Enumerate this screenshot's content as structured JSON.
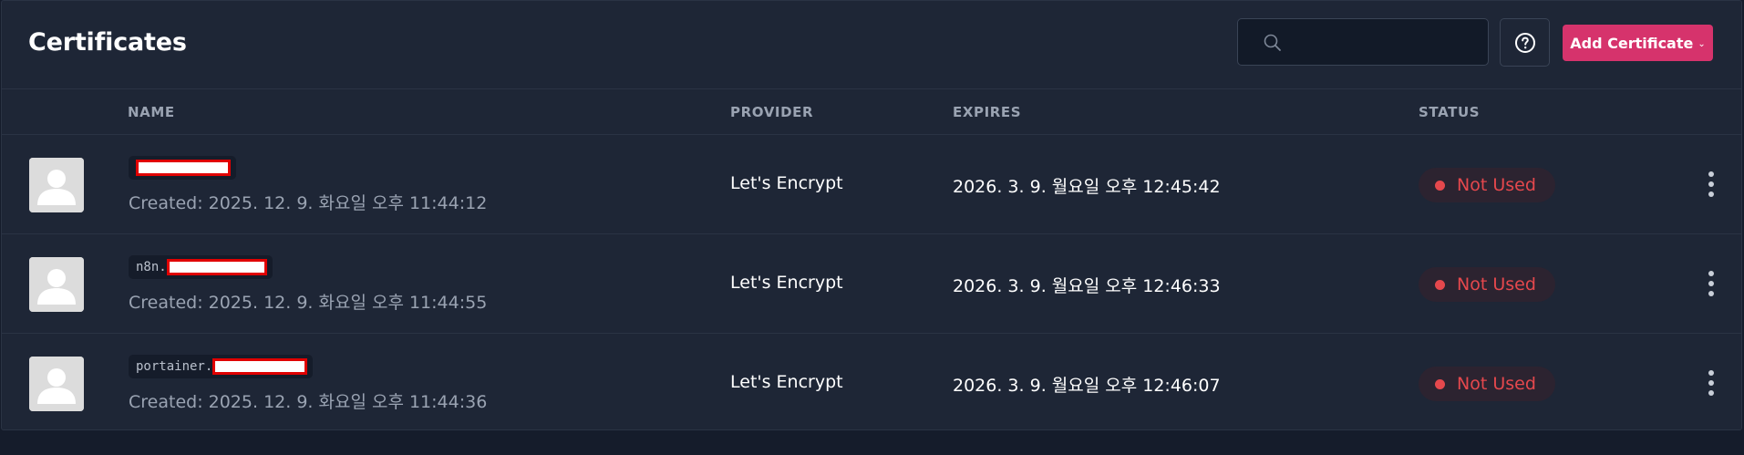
{
  "page": {
    "title": "Certificates"
  },
  "toolbar": {
    "search": {
      "value": "",
      "icon": "search-icon"
    },
    "help_icon": "question-circle-icon",
    "add_label": "Add Certificate",
    "add_caret_icon": "chevron-down-icon",
    "accent_color": "#d6336c"
  },
  "table": {
    "columns": {
      "name": "NAME",
      "provider": "PROVIDER",
      "expires": "EXPIRES",
      "status": "STATUS"
    },
    "rows": [
      {
        "name_prefix": "",
        "created": "Created: 2025. 12. 9. 화요일 오후 11:44:12",
        "provider": "Let's Encrypt",
        "expires": "2026. 3. 9. 월요일 오후 12:45:42",
        "status": "Not Used"
      },
      {
        "name_prefix": "n8n.",
        "created": "Created: 2025. 12. 9. 화요일 오후 11:44:55",
        "provider": "Let's Encrypt",
        "expires": "2026. 3. 9. 월요일 오후 12:46:33",
        "status": "Not Used"
      },
      {
        "name_prefix": "portainer.",
        "created": "Created: 2025. 12. 9. 화요일 오후 11:44:36",
        "provider": "Let's Encrypt",
        "expires": "2026. 3. 9. 월요일 오후 12:46:07",
        "status": "Not Used"
      }
    ],
    "status_color": "#e5484d"
  }
}
